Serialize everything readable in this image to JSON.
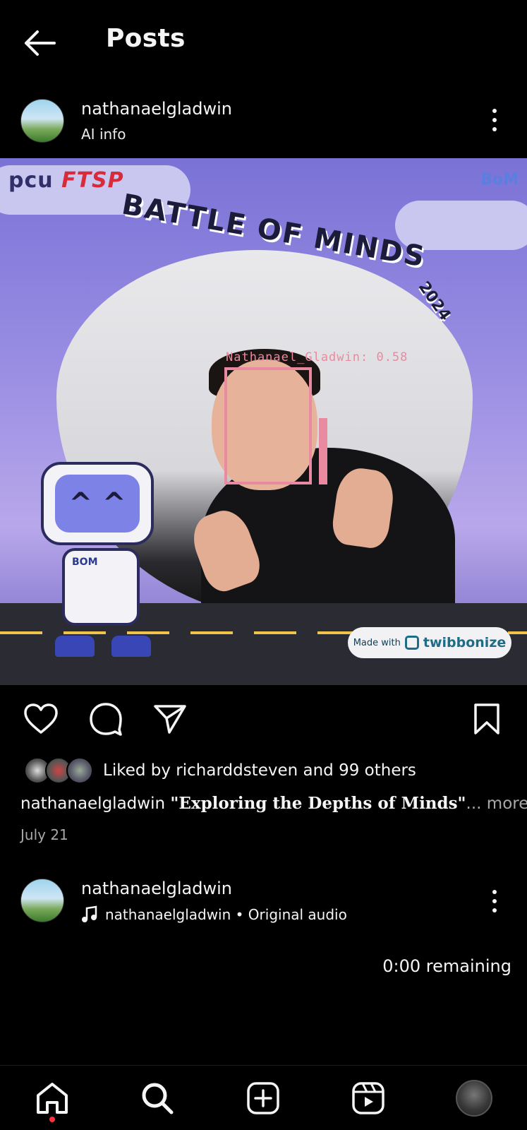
{
  "header": {
    "title": "Posts"
  },
  "post": {
    "author": "nathanaelgladwin",
    "subtitle": "AI info",
    "image": {
      "logo_left_a": "pcu",
      "logo_left_b": "FTSP",
      "logo_right": "BoM",
      "title": "BATTLE OF MINDS",
      "year": "2024",
      "face_label": "Nathanael_Gladwin: 0.58",
      "robot_badge": "BOM",
      "watermark_prefix": "Made with",
      "watermark_brand": "twibbonize"
    },
    "likes_text": "Liked by richarddsteven and 99 others",
    "caption_user": "nathanaelgladwin",
    "caption_text": "\"Exploring the Depths of Minds\"",
    "caption_more": "... more",
    "date": "July 21"
  },
  "next_post": {
    "author": "nathanaelgladwin",
    "audio": "nathanaelgladwin • Original audio",
    "remaining": "0:00 remaining"
  },
  "colors": {
    "background": "#000000",
    "text": "#f5f5f5",
    "muted": "#a8a8a8",
    "notification": "#ff3040",
    "face_box": "#e98aa0"
  },
  "icons": {
    "back": "arrow-left-icon",
    "more": "kebab-icon",
    "like": "heart-icon",
    "comment": "comment-icon",
    "share": "paper-plane-icon",
    "save": "bookmark-icon",
    "audio": "music-note-icon",
    "nav": [
      "home-icon",
      "search-icon",
      "create-icon",
      "reels-icon",
      "profile-icon"
    ]
  }
}
